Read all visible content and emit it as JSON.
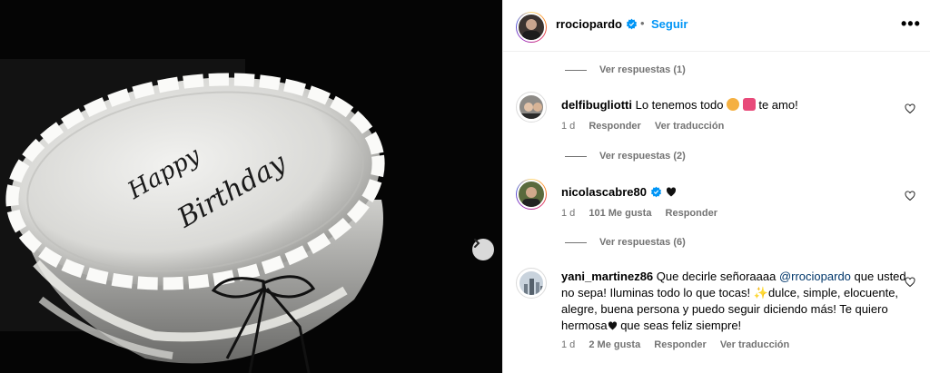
{
  "post": {
    "username": "rrociopardo",
    "follow_label": "Seguir",
    "dot": "•",
    "more_label": "•••",
    "image_text_line1": "Happy",
    "image_text_line2": "Birthday"
  },
  "comments": [
    {
      "view_replies_before": "Ver respuestas (1)",
      "username": "delfibugliotti",
      "text_before": "Lo tenemos todo",
      "text_after": "te amo!",
      "time": "1 d",
      "reply_label": "Responder",
      "translate_label": "Ver traducción"
    },
    {
      "view_replies_before": "Ver respuestas (2)",
      "username": "nicolascabre80",
      "time": "1 d",
      "likes": "101 Me gusta",
      "reply_label": "Responder"
    },
    {
      "view_replies_before": "Ver respuestas (6)",
      "username": "yani_martinez86",
      "text_before": "Que decirle señoraaaa",
      "mention": "@rrociopardo",
      "text_mid": "que usted no sepa! Iluminas todo lo que tocas!",
      "text_after": "dulce, simple, elocuente, alegre, buena persona y puedo seguir diciendo más! Te quiero hermosa",
      "text_end": "que seas feliz siempre!",
      "time": "1 d",
      "likes": "2 Me gusta",
      "reply_label": "Responder",
      "translate_label": "Ver traducción"
    }
  ],
  "colors": {
    "accent": "#0095f6",
    "muted": "#737373",
    "mention": "#00376b"
  }
}
